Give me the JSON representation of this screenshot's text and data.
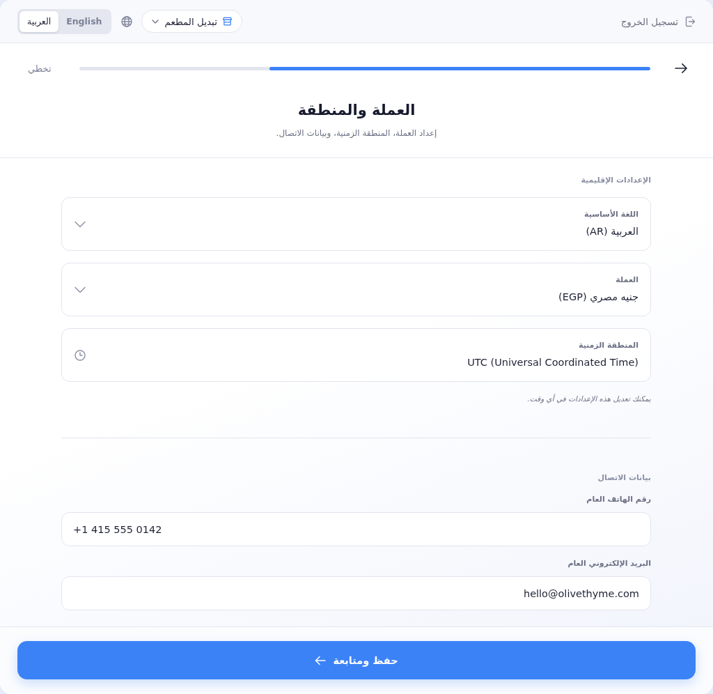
{
  "header": {
    "logout": "تسجيل الخروج",
    "restaurant_switch": "تبديل المطعم",
    "languages": [
      {
        "label": "English",
        "selected": false
      },
      {
        "label": "العربية",
        "selected": true
      }
    ]
  },
  "progress": {
    "level": 0.667,
    "skip": "تخطي"
  },
  "page": {
    "title": "العملة والمنطقة",
    "subtitle": "إعداد العملة، المنطقة الزمنية، وبيانات الاتصال."
  },
  "regional": {
    "heading": "الإعدادات الإقليمية",
    "fields": [
      {
        "kind": "select",
        "label": "اللغة الأساسية",
        "value": "العربية (AR)"
      },
      {
        "kind": "select",
        "label": "العملة",
        "value": "جنيه مصري (EGP)"
      },
      {
        "kind": "time",
        "label": "المنطقة الزمنية",
        "value": "UTC (Universal Coordinated Time)"
      }
    ],
    "hint": "يمكنك تعديل هذه الإعدادات في أي وقت."
  },
  "contact": {
    "heading": "بيانات الاتصال",
    "fields": [
      {
        "kind": "phone",
        "label": "رقم الهاتف العام",
        "value": "+1 415 555 0142"
      },
      {
        "kind": "email",
        "label": "البريد الإلكتروني العام",
        "value": "hello@olivethyme.com"
      }
    ]
  },
  "footer": {
    "button": "حفظ ومتابعة"
  }
}
